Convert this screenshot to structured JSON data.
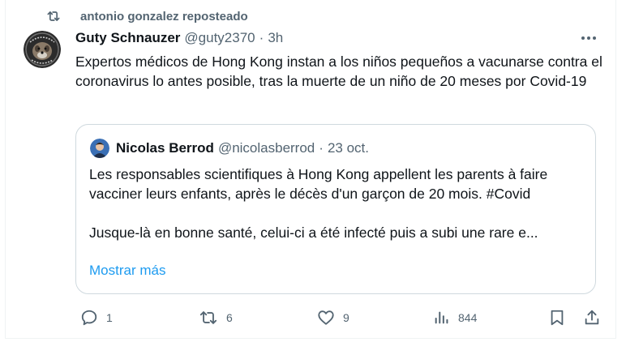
{
  "repost": {
    "text": "antonio gonzalez reposteado",
    "icon": "repost-icon"
  },
  "tweet": {
    "author_name": "Guty Schnauzer",
    "author_handle": "@guty2370",
    "separator": "·",
    "time": "3h",
    "text": "Expertos médicos de Hong Kong instan a los niños pequeños a vacunarse contra el coronavirus lo antes posible, tras la muerte de un niño de 20 meses por Covid-19",
    "more_icon": "more-icon"
  },
  "quote": {
    "author_name": "Nicolas Berrod",
    "author_handle": "@nicolasberrod",
    "separator": "·",
    "time": "23 oct.",
    "paragraph1": "Les responsables scientifiques à Hong Kong appellent les parents à faire vacciner leurs enfants, après le décès d'un garçon de 20 mois. #Covid",
    "paragraph2": "Jusque-là en bonne santé, celui-ci a été infecté puis a subi une rare e...",
    "show_more": "Mostrar más"
  },
  "actions": {
    "reply_count": "1",
    "retweet_count": "6",
    "like_count": "9",
    "views_count": "844"
  },
  "colors": {
    "text_primary": "#0f1419",
    "text_secondary": "#536471",
    "link": "#1d9bf0",
    "border": "#cfd9de"
  }
}
